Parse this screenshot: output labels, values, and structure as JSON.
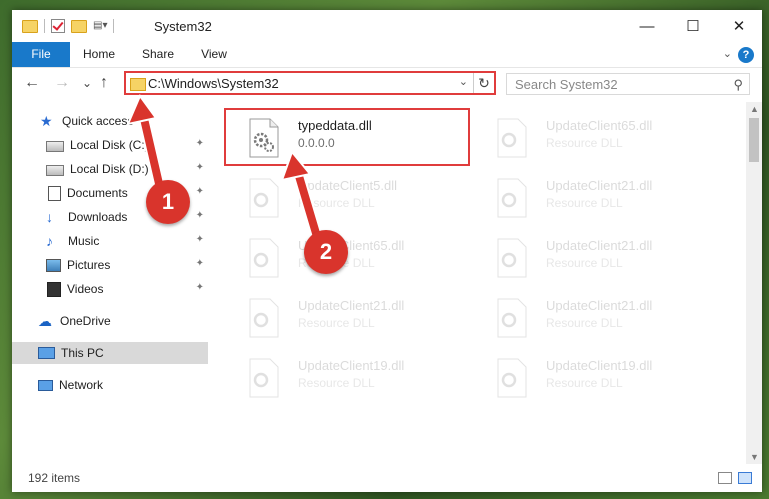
{
  "window": {
    "title": "System32",
    "controls": {
      "minimize": "—",
      "maximize": "☐",
      "close": "✕"
    }
  },
  "ribbon": {
    "tabs": [
      "File",
      "Home",
      "Share",
      "View"
    ],
    "help": "?"
  },
  "navigation": {
    "back": "←",
    "forward": "→",
    "recent": "⌄",
    "up": "↑",
    "address": "C:\\Windows\\System32",
    "refresh": "↻",
    "search_placeholder": "Search System32",
    "search_icon": "⚲"
  },
  "sidebar": {
    "items": [
      {
        "label": "Quick access",
        "icon": "star-icon",
        "pinned": false
      },
      {
        "label": "Local Disk (C:)",
        "icon": "drive-icon",
        "pinned": true
      },
      {
        "label": "Local Disk (D:)",
        "icon": "drive-icon",
        "pinned": true
      },
      {
        "label": "Documents",
        "icon": "document-icon",
        "pinned": true
      },
      {
        "label": "Downloads",
        "icon": "download-icon",
        "pinned": true
      },
      {
        "label": "Music",
        "icon": "music-icon",
        "pinned": true
      },
      {
        "label": "Pictures",
        "icon": "pictures-icon",
        "pinned": true
      },
      {
        "label": "Videos",
        "icon": "videos-icon",
        "pinned": true
      },
      {
        "label": "OneDrive",
        "icon": "cloud-icon",
        "pinned": false
      },
      {
        "label": "This PC",
        "icon": "pc-icon",
        "pinned": false,
        "selected": true
      },
      {
        "label": "Network",
        "icon": "network-icon",
        "pinned": false
      }
    ],
    "pin_glyph": "📌"
  },
  "files": [
    {
      "name": "typeddata.dll",
      "sub": "0.0.0.0",
      "highlighted": true
    },
    {
      "name": "UpdateClient65.dll",
      "sub": "Resource DLL"
    },
    {
      "name": "UpdateClient5.dll",
      "sub": "Resource DLL"
    },
    {
      "name": "UpdateClient21.dll",
      "sub": "Resource DLL"
    },
    {
      "name": "UpdateClient65.dll",
      "sub": "Resource DLL"
    },
    {
      "name": "UpdateClient21.dll",
      "sub": "Resource DLL"
    },
    {
      "name": "UpdateClient21.dll",
      "sub": "Resource DLL"
    },
    {
      "name": "UpdateClient21.dll",
      "sub": "Resource DLL"
    },
    {
      "name": "UpdateClient19.dll",
      "sub": "Resource DLL"
    },
    {
      "name": "UpdateClient19.dll",
      "sub": "Resource DLL"
    }
  ],
  "status": {
    "item_count": "192 items"
  },
  "callouts": [
    "1",
    "2"
  ],
  "colors": {
    "accent": "#1979ca",
    "highlight": "#e03c3c",
    "callout": "#d9342c"
  }
}
